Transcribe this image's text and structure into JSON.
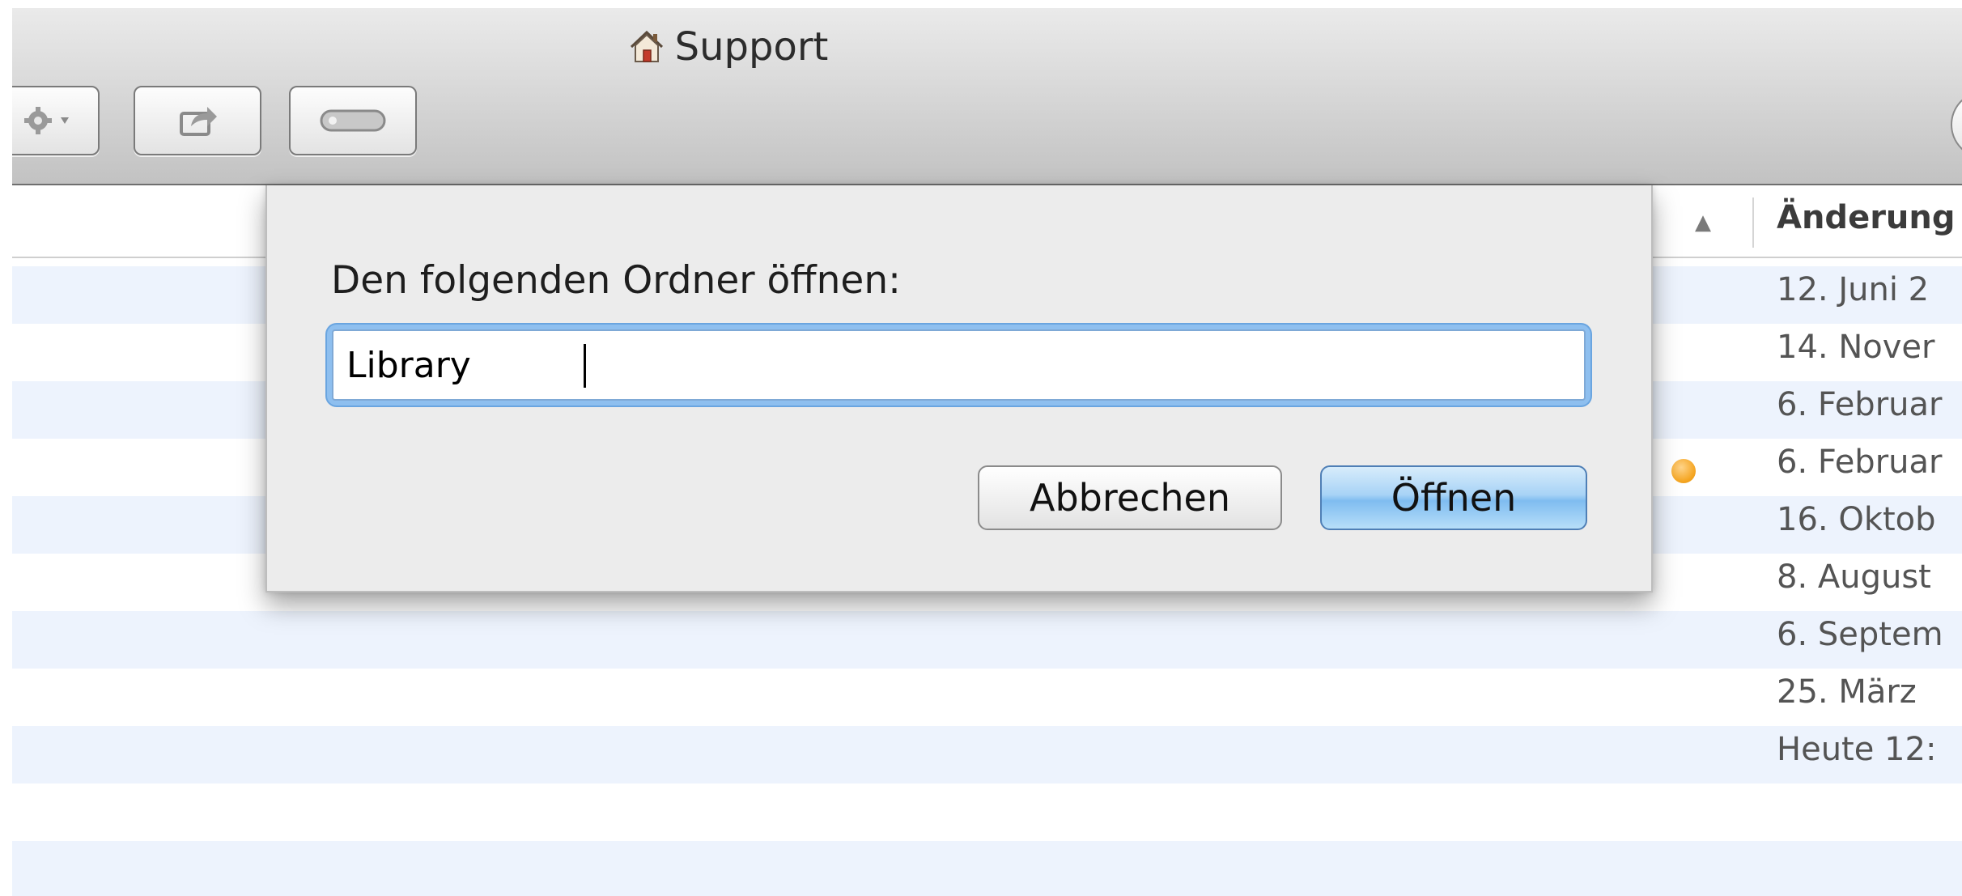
{
  "window": {
    "title": "Support",
    "title_icon": "home-icon"
  },
  "toolbar": {
    "buttons": [
      {
        "name": "action",
        "icon": "gear-icon"
      },
      {
        "name": "share",
        "icon": "share-icon"
      },
      {
        "name": "toggle",
        "icon": "toolbar-toggle-icon"
      }
    ]
  },
  "list": {
    "sort_indicator": "▲",
    "date_column_header": "Änderung",
    "rows": [
      {
        "date": "12. Juni 2"
      },
      {
        "date": "14. Nover"
      },
      {
        "date": "6. Februar"
      },
      {
        "date": "6. Februar",
        "tag_color": "#f5a623"
      },
      {
        "date": "16. Oktob"
      },
      {
        "date": "8. August"
      },
      {
        "date": "6. Septem"
      },
      {
        "date": "25. März"
      },
      {
        "date": "Heute 12:"
      },
      {
        "date": ""
      },
      {
        "date": ""
      }
    ]
  },
  "dialog": {
    "label": "Den folgenden Ordner öffnen:",
    "input_value": "Library",
    "cancel_label": "Abbrechen",
    "open_label": "Öffnen"
  },
  "colors": {
    "row_stripe": "#edf3fd",
    "default_button": "#7fbcf0",
    "focus_ring": "#8ebfef"
  }
}
